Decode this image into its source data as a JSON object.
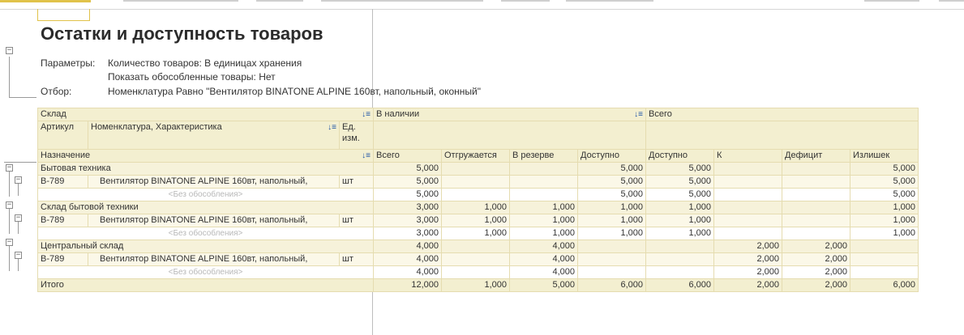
{
  "report": {
    "title": "Остатки и доступность товаров",
    "params_label": "Параметры:",
    "param1": "Количество товаров: В единицах хранения",
    "param2": "Показать обособленные товары: Нет",
    "filter_label": "Отбор:",
    "filter_value": "Номенклатура Равно \"Вентилятор BINATONE ALPINE 160вт, напольный, оконный\""
  },
  "headers": {
    "warehouse": "Склад",
    "article": "Артикул",
    "nomenclature": "Номенклатура, Характеристика",
    "unit": "Ед. изм.",
    "purpose": "Назначение",
    "in_stock": "В наличии",
    "total_group": "Всего",
    "cols": [
      "Всего",
      "Отгружается",
      "В резерве",
      "Доступно",
      "Доступно",
      "К",
      "Дефицит",
      "Излишек"
    ],
    "sort_icon": "↓≡"
  },
  "rows": [
    {
      "type": "group",
      "label": "Бытовая техника",
      "vals": [
        "5,000",
        "",
        "",
        "5,000",
        "5,000",
        "",
        "",
        "5,000"
      ]
    },
    {
      "type": "item",
      "article": "B-789",
      "name": "Вентилятор BINATONE ALPINE 160вт, напольный,",
      "unit": "шт",
      "vals": [
        "5,000",
        "",
        "",
        "5,000",
        "5,000",
        "",
        "",
        "5,000"
      ]
    },
    {
      "type": "sub",
      "label": "<Без обособления>",
      "vals": [
        "5,000",
        "",
        "",
        "5,000",
        "5,000",
        "",
        "",
        "5,000"
      ]
    },
    {
      "type": "group",
      "label": "Склад бытовой техники",
      "vals": [
        "3,000",
        "1,000",
        "1,000",
        "1,000",
        "1,000",
        "",
        "",
        "1,000"
      ]
    },
    {
      "type": "item",
      "article": "B-789",
      "name": "Вентилятор BINATONE ALPINE 160вт, напольный,",
      "unit": "шт",
      "vals": [
        "3,000",
        "1,000",
        "1,000",
        "1,000",
        "1,000",
        "",
        "",
        "1,000"
      ]
    },
    {
      "type": "sub",
      "label": "<Без обособления>",
      "vals": [
        "3,000",
        "1,000",
        "1,000",
        "1,000",
        "1,000",
        "",
        "",
        "1,000"
      ]
    },
    {
      "type": "group",
      "label": "Центральный склад",
      "vals": [
        "4,000",
        "",
        "4,000",
        "",
        "",
        "2,000",
        "2,000",
        ""
      ]
    },
    {
      "type": "item",
      "article": "B-789",
      "name": "Вентилятор BINATONE ALPINE 160вт, напольный,",
      "unit": "шт",
      "vals": [
        "4,000",
        "",
        "4,000",
        "",
        "",
        "2,000",
        "2,000",
        ""
      ]
    },
    {
      "type": "sub",
      "label": "<Без обособления>",
      "vals": [
        "4,000",
        "",
        "4,000",
        "",
        "",
        "2,000",
        "2,000",
        ""
      ]
    }
  ],
  "total": {
    "label": "Итого",
    "vals": [
      "12,000",
      "1,000",
      "5,000",
      "6,000",
      "6,000",
      "2,000",
      "2,000",
      "6,000"
    ]
  },
  "toggles": {
    "collapse": "−"
  }
}
